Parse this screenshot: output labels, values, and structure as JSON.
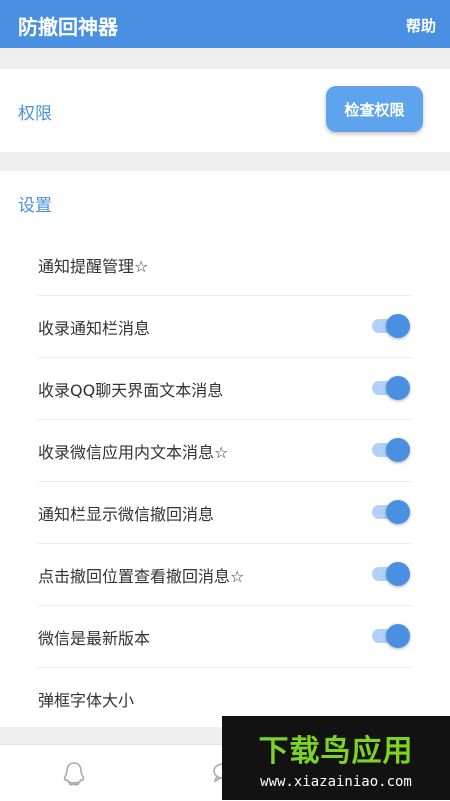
{
  "appbar": {
    "title": "防撤回神器",
    "help": "帮助"
  },
  "permission": {
    "label": "权限",
    "button": "检查权限"
  },
  "settings": {
    "label": "设置",
    "items": [
      {
        "label": "通知提醒管理☆",
        "toggle": null
      },
      {
        "label": "收录通知栏消息",
        "toggle": true
      },
      {
        "label": "收录QQ聊天界面文本消息",
        "toggle": true
      },
      {
        "label": "收录微信应用内文本消息☆",
        "toggle": true
      },
      {
        "label": "通知栏显示微信撤回消息",
        "toggle": true
      },
      {
        "label": "点击撤回位置查看撤回消息☆",
        "toggle": true
      },
      {
        "label": "微信是最新版本",
        "toggle": true
      },
      {
        "label": "弹框字体大小",
        "toggle": null
      }
    ]
  },
  "bottom_nav": {
    "icons": [
      "qq-icon",
      "chat-icon"
    ]
  },
  "watermark": {
    "title": "下载鸟应用",
    "url": "www.xiazainiao.com"
  },
  "colors": {
    "primary": "#4a90e2",
    "button": "#5ea3ee",
    "toggle_track": "#b3d1f6"
  }
}
